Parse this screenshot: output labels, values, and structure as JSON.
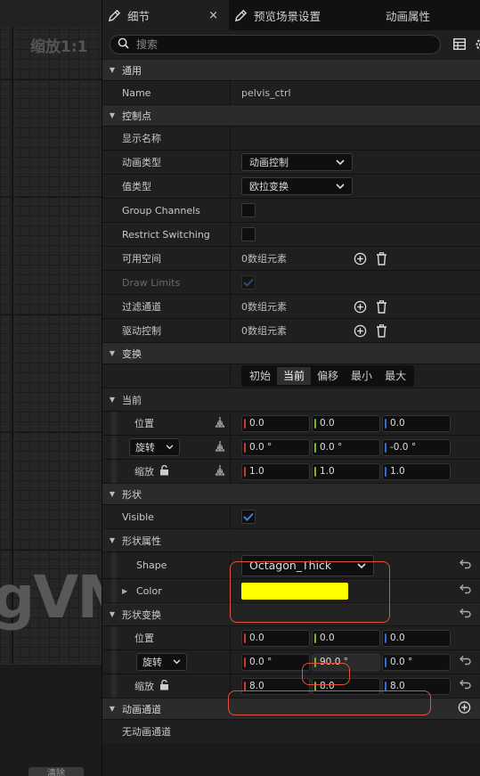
{
  "viewport": {
    "zoom": "缩放1:1",
    "watermark": "gVM",
    "clear_button": "清除"
  },
  "tabs": [
    {
      "label": "细节",
      "close": "×"
    },
    {
      "label": "预览场景设置"
    },
    {
      "label": "动画属性"
    }
  ],
  "search": {
    "placeholder": "搜索"
  },
  "sections": {
    "general": {
      "title": "通用",
      "name_label": "Name",
      "name_value": "pelvis_ctrl"
    },
    "control": {
      "title": "控制点",
      "display_name": "显示名称",
      "anim_type_label": "动画类型",
      "anim_type_value": "动画控制",
      "value_type_label": "值类型",
      "value_type_value": "欧拉变换",
      "group_channels": "Group Channels",
      "restrict_switching": "Restrict Switching",
      "available_space": "可用空间",
      "available_space_value": "0数组元素",
      "draw_limits": "Draw Limits",
      "filter_channels": "过滤通道",
      "filter_channels_value": "0数组元素",
      "driven_controls": "驱动控制",
      "driven_controls_value": "0数组元素"
    },
    "transform": {
      "title": "变换",
      "modes": [
        "初始",
        "当前",
        "偏移",
        "最小",
        "最大"
      ],
      "current_title": "当前",
      "location_label": "位置",
      "location": [
        "0.0",
        "0.0",
        "0.0"
      ],
      "rotation_label": "旋转",
      "rotation": [
        "0.0 °",
        "0.0 °",
        "-0.0 °"
      ],
      "scale_label": "缩放",
      "scale": [
        "1.0",
        "1.0",
        "1.0"
      ]
    },
    "shape": {
      "title": "形状",
      "visible_label": "Visible",
      "props_title": "形状属性",
      "shape_label": "Shape",
      "shape_value": "Octagon_Thick",
      "color_label": "Color",
      "color_value": "#ffff00",
      "transform_title": "形状变换",
      "location_label": "位置",
      "location": [
        "0.0",
        "0.0",
        "0.0"
      ],
      "rotation_label": "旋转",
      "rotation": [
        "0.0 °",
        "90.0 °",
        "0.0 °"
      ],
      "scale_label": "缩放",
      "scale": [
        "8.0",
        "8.0",
        "8.0"
      ]
    },
    "anim_channels": {
      "title": "动画通道",
      "empty": "无动画通道"
    }
  },
  "colors": {
    "accent_blue": "#2a70c8",
    "highlight_red": "#e0523f",
    "axis_x": "#d13a29",
    "axis_y": "#7db51e",
    "axis_z": "#2f6ed6"
  }
}
